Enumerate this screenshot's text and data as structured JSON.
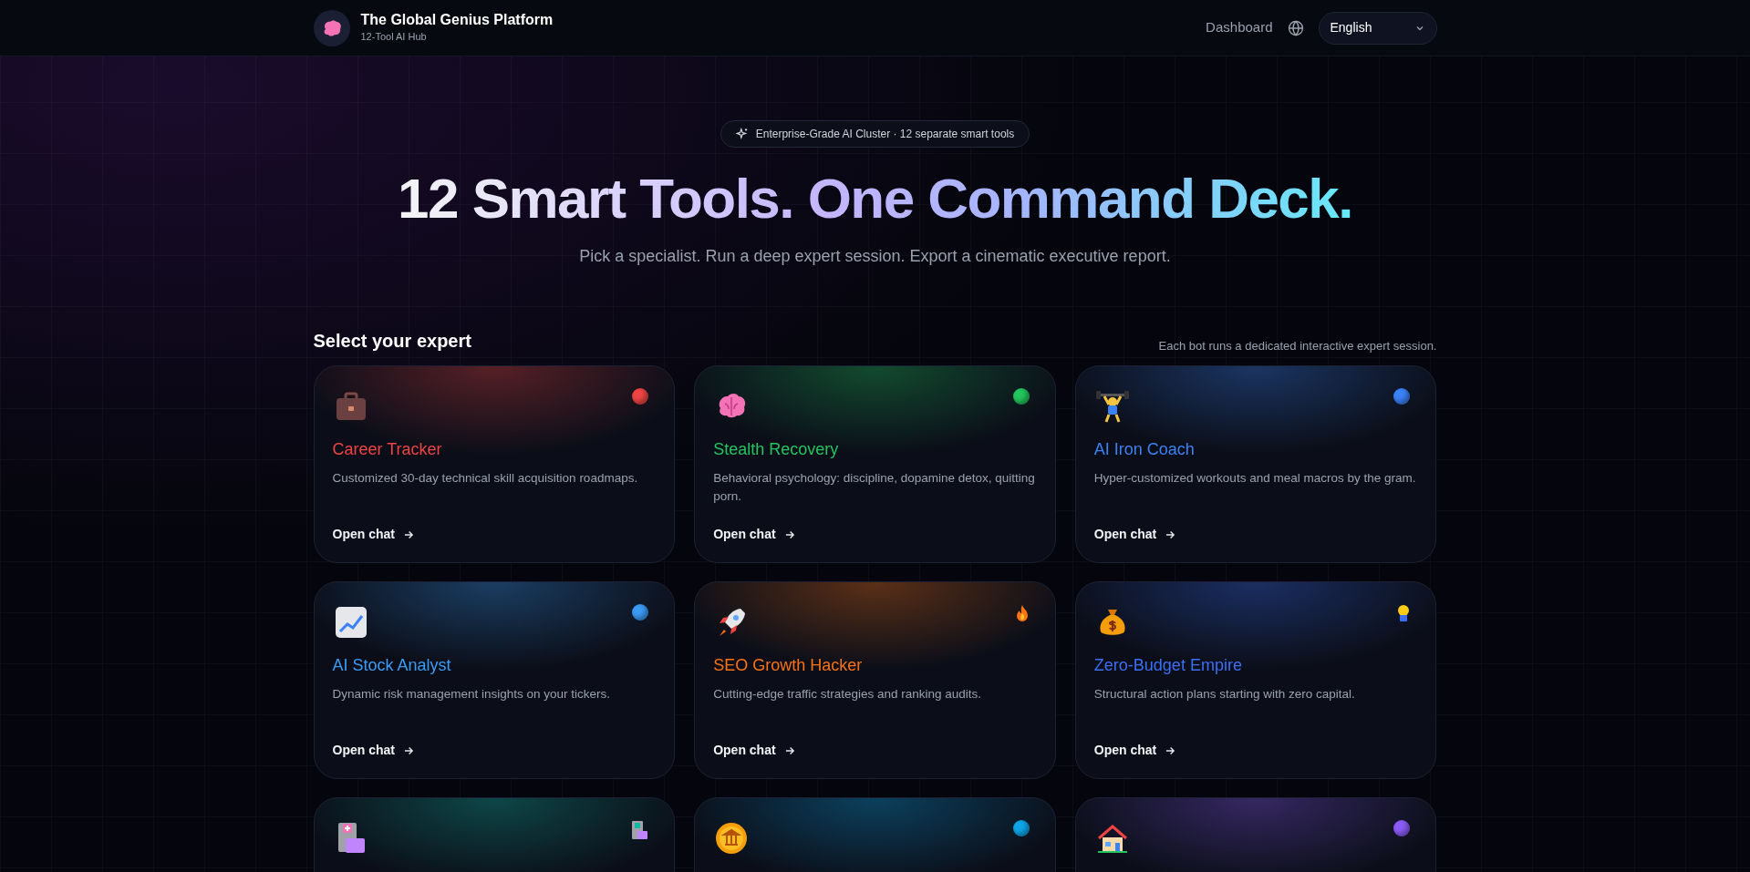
{
  "header": {
    "brand": "The Global Genius Platform",
    "tagline": "12-Tool AI Hub",
    "nav_link": "Dashboard",
    "language": "English"
  },
  "hero": {
    "badge": "Enterprise-Grade AI Cluster · 12 separate smart tools",
    "headline": "12 Smart Tools. One Command Deck.",
    "subtitle": "Pick a specialist. Run a deep expert session. Export a cinematic executive report."
  },
  "section": {
    "title": "Select your expert",
    "note": "Each bot runs a dedicated interactive expert session."
  },
  "cards": [
    {
      "color": "#ef4444",
      "title": "Career Tracker",
      "description": "Customized 30-day technical skill acquisition roadmaps.",
      "action": "Open chat"
    },
    {
      "color": "#22c55e",
      "title": "Stealth Recovery",
      "description": "Behavioral psychology: discipline, dopamine detox, quitting porn.",
      "action": "Open chat"
    },
    {
      "color": "#3b82f6",
      "title": "AI Iron Coach",
      "description": "Hyper-customized workouts and meal macros by the gram.",
      "action": "Open chat"
    },
    {
      "color": "#3b9cf6",
      "title": "AI Stock Analyst",
      "description": "Dynamic risk management insights on your tickers.",
      "action": "Open chat"
    },
    {
      "color": "#f97316",
      "title": "SEO Growth Hacker",
      "description": "Cutting-edge traffic strategies and ranking audits.",
      "action": "Open chat"
    },
    {
      "color": "#3b6ff6",
      "title": "Zero-Budget Empire",
      "description": "Structural action plans starting with zero capital.",
      "action": "Open chat"
    },
    {
      "color": "#14b8a6"
    },
    {
      "color": "#0ea5e9"
    },
    {
      "color": "#8b5cf6"
    }
  ]
}
